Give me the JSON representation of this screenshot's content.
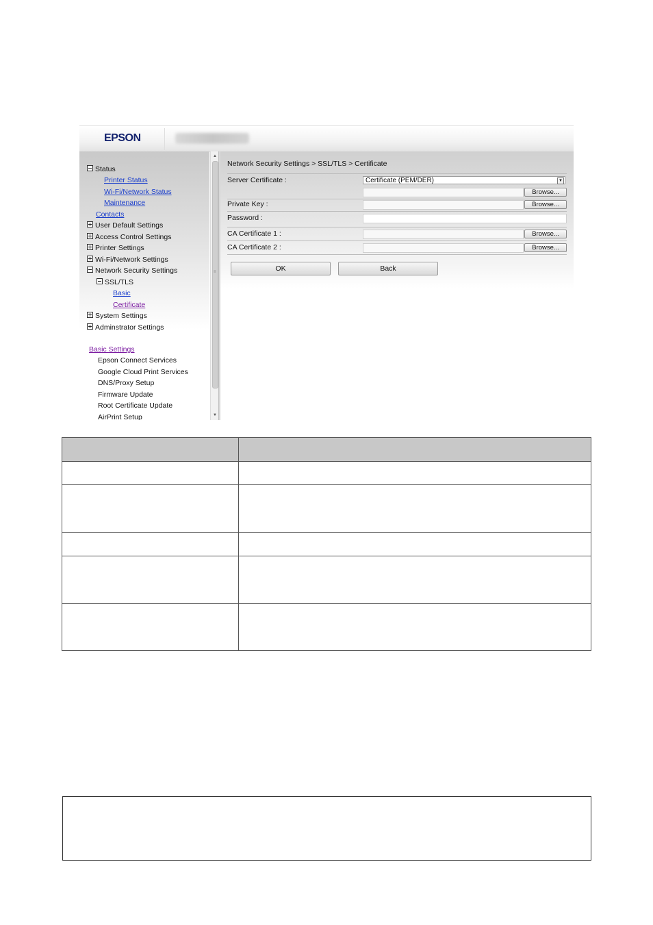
{
  "header": {
    "logo": "EPSON"
  },
  "breadcrumb": "Network Security Settings > SSL/TLS > Certificate",
  "sidebar": {
    "tree": [
      {
        "label": "Status",
        "toggle": "minus"
      },
      {
        "label": "Printer Status"
      },
      {
        "label": "Wi-Fi/Network Status"
      },
      {
        "label": "Maintenance"
      },
      {
        "label": "Contacts"
      },
      {
        "label": "User Default Settings",
        "toggle": "plus"
      },
      {
        "label": "Access Control Settings",
        "toggle": "plus"
      },
      {
        "label": "Printer Settings",
        "toggle": "plus"
      },
      {
        "label": "Wi-Fi/Network Settings",
        "toggle": "plus"
      },
      {
        "label": "Network Security Settings",
        "toggle": "minus"
      },
      {
        "label": "SSL/TLS",
        "toggle": "minus"
      },
      {
        "label": "Basic"
      },
      {
        "label": "Certificate"
      },
      {
        "label": "System Settings",
        "toggle": "plus"
      },
      {
        "label": "Adminstrator Settings",
        "toggle": "plus"
      }
    ],
    "basic_settings": {
      "label": "Basic Settings",
      "items": [
        "Epson Connect Services",
        "Google Cloud Print Services",
        "DNS/Proxy Setup",
        "Firmware Update",
        "Root Certificate Update",
        "AirPrint Setup"
      ]
    }
  },
  "form": {
    "server_certificate": {
      "label": "Server Certificate :",
      "selected": "Certificate (PEM/DER)"
    },
    "private_key": {
      "label": "Private Key :"
    },
    "password": {
      "label": "Password :"
    },
    "ca_certificate_1": {
      "label": "CA Certificate 1 :"
    },
    "ca_certificate_2": {
      "label": "CA Certificate 2 :"
    },
    "browse_label": "Browse...",
    "ok_label": "OK",
    "back_label": "Back"
  }
}
